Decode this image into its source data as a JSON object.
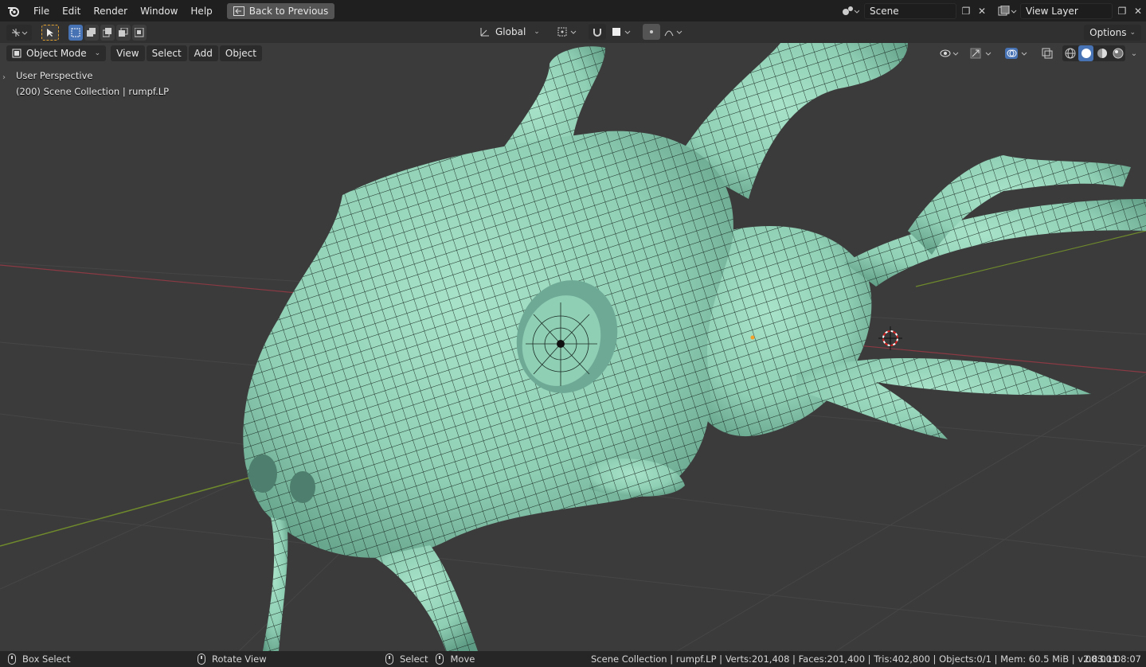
{
  "menubar": {
    "items": [
      "File",
      "Edit",
      "Render",
      "Window",
      "Help"
    ],
    "back_button": "Back to Previous",
    "scene_label": "Scene",
    "view_layer_label": "View Layer"
  },
  "toolbar": {
    "transform_orientation": "Global",
    "options_label": "Options"
  },
  "header": {
    "mode": "Object Mode",
    "menus": [
      "View",
      "Select",
      "Add",
      "Object"
    ]
  },
  "viewport": {
    "perspective": "User Perspective",
    "collection_info": "(200) Scene Collection | rumpf.LP",
    "mesh_color": "#8fcfb4",
    "wire_color": "#1a2a24",
    "bg_color": "#3b3b3b"
  },
  "statusbar": {
    "left_hint": "Box Select",
    "middle_hint": "Rotate View",
    "right_hint_select": "Select",
    "right_hint_move": "Move",
    "stats": "Scene Collection | rumpf.LP | Verts:201,408 | Faces:201,400 | Tris:402,800 | Objects:0/1 | Mem: 60.5 MiB | v2.83.11",
    "time": "00:00:08:07"
  },
  "icons": {
    "blender_logo": "blender-logo-icon",
    "back": "back-arrow-icon",
    "scene": "scene-icon",
    "view_layer": "view-layer-icon",
    "select_tool": "cursor-select-icon",
    "box_modes": "selection-mode-icons",
    "pivot": "pivot-icon",
    "snap": "snap-magnet-icon",
    "proportional": "proportional-edit-icon",
    "visibility": "eye-icon",
    "gizmo": "gizmo-icon",
    "overlay": "overlay-icon",
    "xray": "xray-icon",
    "shading": "shading-mode-icons"
  }
}
